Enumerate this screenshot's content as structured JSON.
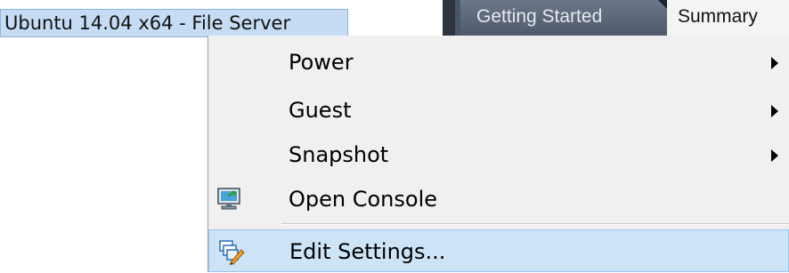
{
  "vm": {
    "name": "Ubuntu 14.04 x64 - File Server"
  },
  "tabs": [
    {
      "label": "Getting Started"
    },
    {
      "label": "Summary"
    }
  ],
  "context_menu": {
    "items": [
      {
        "label": "Power",
        "has_submenu": true,
        "icon": ""
      },
      {
        "label": "Guest",
        "has_submenu": true,
        "icon": ""
      },
      {
        "label": "Snapshot",
        "has_submenu": true,
        "icon": ""
      },
      {
        "label": "Open Console",
        "has_submenu": false,
        "icon": "console-icon"
      },
      {
        "label": "Edit Settings...",
        "has_submenu": false,
        "icon": "edit-settings-icon",
        "highlighted": true
      }
    ]
  },
  "colors": {
    "selection": "#c5dcf4",
    "menu_background": "#f0f0f0",
    "menu_highlight": "#cde4f7",
    "tab_strip": "#4a5568"
  }
}
